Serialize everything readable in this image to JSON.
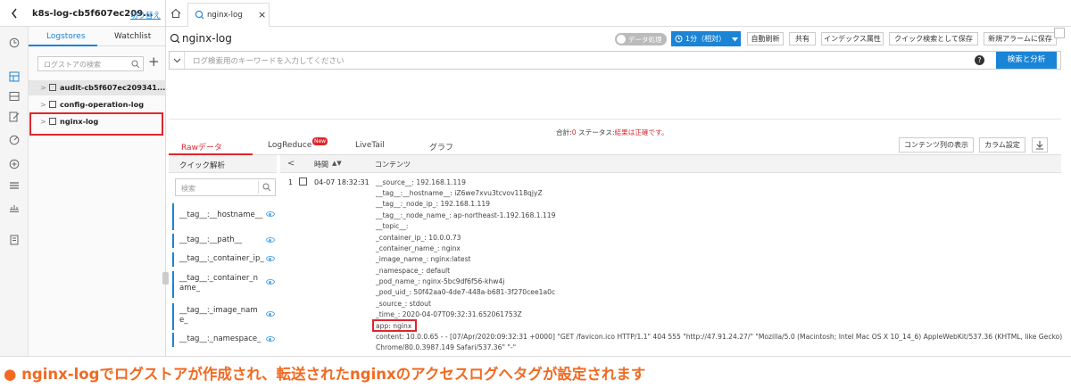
{
  "topbar": {
    "back_icon": "chevron-left-icon",
    "project_name": "k8s-log-cb5f607ec209...",
    "switch_label": "切り替え",
    "home_icon": "home-icon",
    "tab_label": "nginx-log",
    "tab_close": "×"
  },
  "sidebar_icons": [
    "clock-icon",
    "logstore-icon",
    "dashboard-icon",
    "edit-icon",
    "alarm-icon",
    "data-icon",
    "list-icon",
    "settings-icon",
    "doc-icon"
  ],
  "store_panel": {
    "tabs": [
      "Logstores",
      "Watchlist"
    ],
    "search_placeholder": "ログストアの検索",
    "add": "+",
    "items": [
      "audit-cb5f607ec209341...",
      "config-operation-log",
      "nginx-log"
    ]
  },
  "header": {
    "title": "nginx-log",
    "toggle_label": "データ処理",
    "time_label": "1分（相対）",
    "buttons": [
      "自動刷新",
      "共有",
      "インデックス属性",
      "クイック検索として保存",
      "新規アラームに保存"
    ]
  },
  "query": {
    "placeholder": "ログ検索用のキーワードを入力してください",
    "search_button": "検索と分析",
    "help": "?"
  },
  "status": {
    "total_label": "合計:",
    "total_value": "0",
    "status_label": "ステータス:",
    "status_value": "結果は正確です。"
  },
  "result_tabs": {
    "items": [
      "Rawデータ",
      "LogReduce",
      "LiveTail",
      "グラフ"
    ],
    "new_badge": "New",
    "right_buttons": [
      "コンテンツ列の表示",
      "カラム設定"
    ],
    "download_icon": "download-icon"
  },
  "quick": {
    "title": "クイック解析",
    "search_placeholder": "検索",
    "fields": [
      "__tag__:__hostname__",
      "__tag__:__path__",
      "__tag__:_container_ip_",
      "__tag__:_container_name_",
      "__tag__:_image_name_",
      "__tag__:_namespace_"
    ]
  },
  "table": {
    "time_header": "時間",
    "content_header": "コンテンツ",
    "row_index": "1",
    "row_time": "04-07 18:32:31",
    "lines": [
      "__source__:  192.168.1.119",
      "__tag__:__hostname__:  iZ6we7xvu3tcvov118qjyZ",
      "__tag__:_node_ip_:  192.168.1.119",
      "__tag__:_node_name_:  ap-northeast-1.192.168.1.119",
      "__topic__:",
      "_container_ip_:  10.0.0.73",
      "_container_name_:  nginx",
      "_image_name_:  nginx:latest",
      "_namespace_:  default",
      "_pod_name_:  nginx-5bc9df6f56-khw4j",
      "_pod_uid_:  50f42aa0-4de7-448a-b681-3f270cee1a0c",
      "_source_:  stdout",
      "_time_:  2020-04-07T09:32:31.652061753Z",
      "app:  nginx",
      "content:  10.0.0.65 - - [07/Apr/2020:09:32:31 +0000] \"GET /favicon.ico HTTP/1.1\" 404 555 \"http://47.91.24.27/\" \"Mozilla/5.0 (Macintosh; Intel Mac OS X 10_14_6) AppleWebKit/537.36 (KHTML, like Gecko)",
      "Chrome/80.0.3987.149 Safari/537.36\" \"-\""
    ]
  },
  "caption": "● nginx-logでログストアが作成され、転送されたnginxのアクセスログへタグが設定されます",
  "colors": {
    "accent": "#1a84d6",
    "highlight": "#e0262d",
    "caption": "#f26a21"
  }
}
